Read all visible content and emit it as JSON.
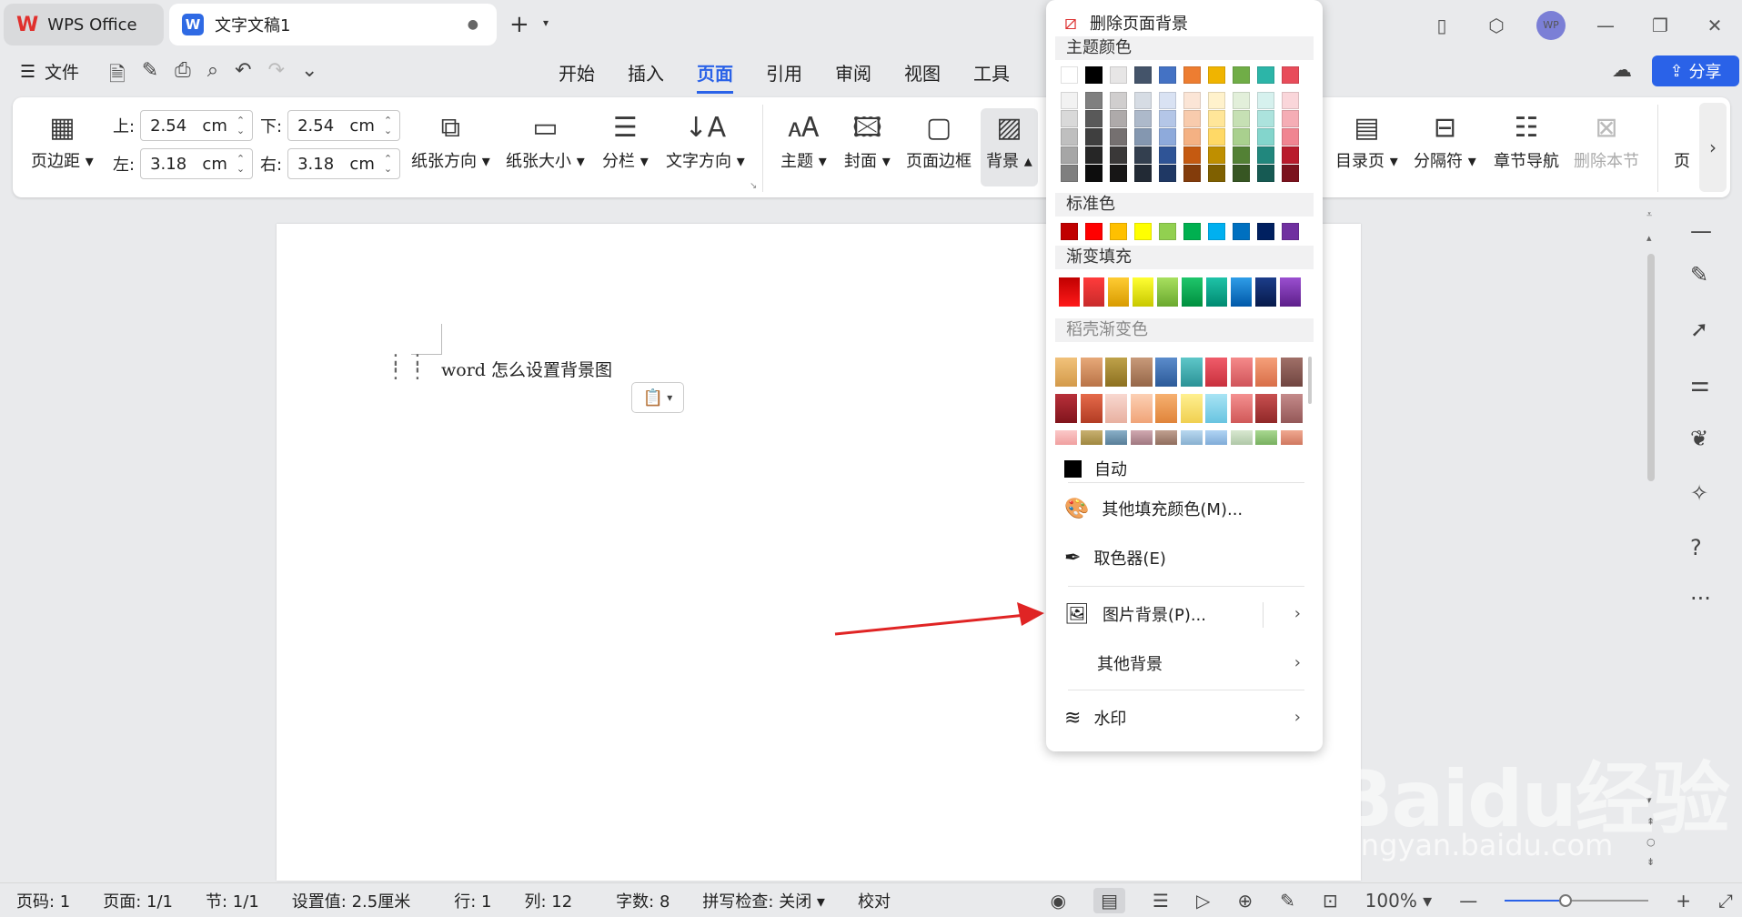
{
  "titlebar": {
    "home_tab": "WPS Office",
    "doc_tab": "文字文稿1",
    "doc_tab_icon": "W",
    "avatar": "WP"
  },
  "menubar": {
    "file": "文件",
    "tabs": [
      "开始",
      "插入",
      "页面",
      "引用",
      "审阅",
      "视图",
      "工具"
    ],
    "active_tab": "页面",
    "share": "分享"
  },
  "ribbon": {
    "margins": "页边距",
    "top_label": "上:",
    "top_value": "2.54",
    "top_unit": "cm",
    "bottom_label": "下:",
    "bottom_value": "2.54",
    "bottom_unit": "cm",
    "left_label": "左:",
    "left_value": "3.18",
    "left_unit": "cm",
    "right_label": "右:",
    "right_value": "3.18",
    "right_unit": "cm",
    "orientation": "纸张方向",
    "size": "纸张大小",
    "columns": "分栏",
    "text_direction": "文字方向",
    "theme": "主题",
    "cover": "封面",
    "page_border": "页面边框",
    "background": "背景",
    "toc_page": "目录页",
    "separator": "分隔符",
    "section_nav": "章节导航",
    "delete_section": "删除本节",
    "cut_off": "页"
  },
  "document": {
    "text": "word 怎么设置背景图"
  },
  "panel": {
    "remove_bg": "删除页面背景",
    "theme_colors_title": "主题颜色",
    "theme_top_row": [
      "#ffffff",
      "#000000",
      "#e7e6e6",
      "#44546a",
      "#4472c4",
      "#ed7d31",
      "#f0b400",
      "#70ad47",
      "#2cb5a8",
      "#e84c5a"
    ],
    "theme_shades": [
      [
        "#f2f2f2",
        "#7f7f7f",
        "#d0cece",
        "#d6dce4",
        "#d9e2f3",
        "#fbe5d6",
        "#fff2cc",
        "#e2efda",
        "#d6f1ee",
        "#fad6da"
      ],
      [
        "#d9d9d9",
        "#595959",
        "#aeaaaa",
        "#adb9ca",
        "#b4c6e7",
        "#f8cbad",
        "#ffe699",
        "#c6e0b4",
        "#ace3dd",
        "#f5adb5"
      ],
      [
        "#bfbfbf",
        "#3f3f3f",
        "#757070",
        "#8497b0",
        "#8eaadb",
        "#f4b183",
        "#ffd966",
        "#a9d08e",
        "#83d5cc",
        "#f08591"
      ],
      [
        "#a6a6a6",
        "#262626",
        "#3a3838",
        "#333f4f",
        "#2f5496",
        "#c55a11",
        "#bf8f00",
        "#538135",
        "#21877d",
        "#b91b2c"
      ],
      [
        "#7f7f7f",
        "#0d0d0d",
        "#171616",
        "#222a35",
        "#1f3864",
        "#833c0b",
        "#7f6000",
        "#375623",
        "#165a53",
        "#7b121d"
      ]
    ],
    "standard_title": "标准色",
    "standard_colors": [
      "#c00000",
      "#ff0000",
      "#ffc000",
      "#ffff00",
      "#92d050",
      "#00b050",
      "#00b0f0",
      "#0070c0",
      "#002060",
      "#7030a0"
    ],
    "gradient_title": "渐变填充",
    "gradient_colors": [
      [
        "#c00000",
        "#ff1a1a"
      ],
      [
        "#ff3b3b",
        "#c82b2b"
      ],
      [
        "#ffcc33",
        "#d89b00"
      ],
      [
        "#ffff33",
        "#c8c800"
      ],
      [
        "#a8e05f",
        "#6aa82e"
      ],
      [
        "#1fc66b",
        "#008f3f"
      ],
      [
        "#1fc3a8",
        "#008a70"
      ],
      [
        "#2f9de8",
        "#0058a8"
      ],
      [
        "#1c3d8a",
        "#071a4a"
      ],
      [
        "#9a4fd0",
        "#5d1f8a"
      ]
    ],
    "docer_title": "稻壳渐变色",
    "docer_rows": [
      [
        [
          "#f1c27b",
          "#d39a4a"
        ],
        [
          "#e7a979",
          "#b97347"
        ],
        [
          "#bfa24a",
          "#8c7020"
        ],
        [
          "#c89a7a",
          "#956648"
        ],
        [
          "#5b8ccc",
          "#2c5a98"
        ],
        [
          "#5ec7c9",
          "#2b9296"
        ],
        [
          "#f05c6a",
          "#c8303d"
        ],
        [
          "#f58a8a",
          "#d0545a"
        ],
        [
          "#f5a07a",
          "#d86e48"
        ],
        [
          "#a07068",
          "#704540"
        ]
      ],
      [
        [
          "#b8303a",
          "#80141c"
        ],
        [
          "#e56a4a",
          "#b23c24"
        ],
        [
          "#f8d8d0",
          "#e8b0a0"
        ],
        [
          "#fcd0b4",
          "#f0a478"
        ],
        [
          "#f6b070",
          "#e0843a"
        ],
        [
          "#fff090",
          "#f0d050"
        ],
        [
          "#a8e4f4",
          "#68c4e0"
        ],
        [
          "#f49090",
          "#d05858"
        ],
        [
          "#c85050",
          "#902828"
        ],
        [
          "#c48a8a",
          "#945858"
        ]
      ],
      [
        [
          "#fbc8c8",
          "#f0a0a0"
        ],
        [
          "#c8b070",
          "#a08840"
        ],
        [
          "#8ab0c8",
          "#587e98"
        ],
        [
          "#d0a8b0",
          "#a07880"
        ],
        [
          "#c0a090",
          "#906e5e"
        ],
        [
          "#b8d8f0",
          "#88b0d0"
        ],
        [
          "#b0d4f4",
          "#80acd8"
        ],
        [
          "#d8e8d0",
          "#b0c8a8"
        ],
        [
          "#a8d890",
          "#78b060"
        ],
        [
          "#f0a890",
          "#d07860"
        ]
      ]
    ],
    "auto": "自动",
    "more_fill": "其他填充颜色(M)...",
    "eyedropper": "取色器(E)",
    "picture_bg": "图片背景(P)...",
    "other_bg": "其他背景",
    "watermark": "水印"
  },
  "statusbar": {
    "page_num": "页码: 1",
    "pages": "页面: 1/1",
    "section": "节: 1/1",
    "setting": "设置值: 2.5厘米",
    "row": "行: 1",
    "col": "列: 12",
    "words": "字数: 8",
    "spell": "拼写检查: 关闭",
    "proof": "校对",
    "zoom": "100%",
    "zoom_fraction": 0.42
  },
  "watermark": {
    "brand": "Baidu经验",
    "url": "jingyan.baidu.com"
  },
  "colors": {
    "accent": "#2a62e8",
    "arrow": "#e02424"
  }
}
